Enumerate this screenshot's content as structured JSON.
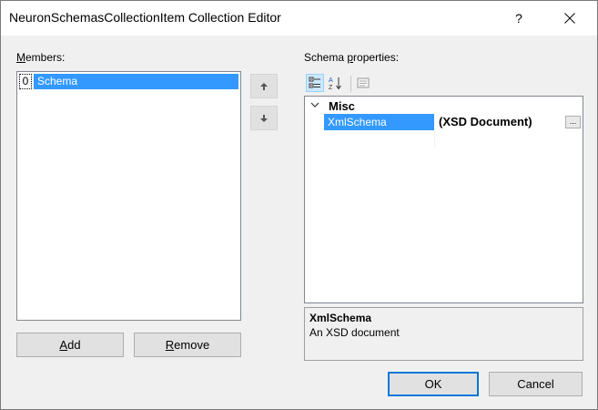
{
  "window": {
    "title": "NeuronSchemasCollectionItem Collection Editor",
    "help_glyph": "?",
    "close_glyph": "✕"
  },
  "members": {
    "label_prefix": "",
    "label_accel": "M",
    "label_rest": "embers:",
    "items": [
      {
        "index": "0",
        "label": "Schema",
        "selected": true
      }
    ]
  },
  "buttons": {
    "add_accel": "A",
    "add_rest": "dd",
    "remove_accel": "R",
    "remove_rest": "emove",
    "ok": "OK",
    "cancel": "Cancel"
  },
  "properties": {
    "label_prefix": "Schema ",
    "label_accel": "p",
    "label_rest": "roperties:",
    "category": "Misc",
    "rows": [
      {
        "name": "XmlSchema",
        "value": "(XSD Document)",
        "ellipsis": "..."
      }
    ]
  },
  "description": {
    "title": "XmlSchema",
    "text": "An XSD document"
  }
}
